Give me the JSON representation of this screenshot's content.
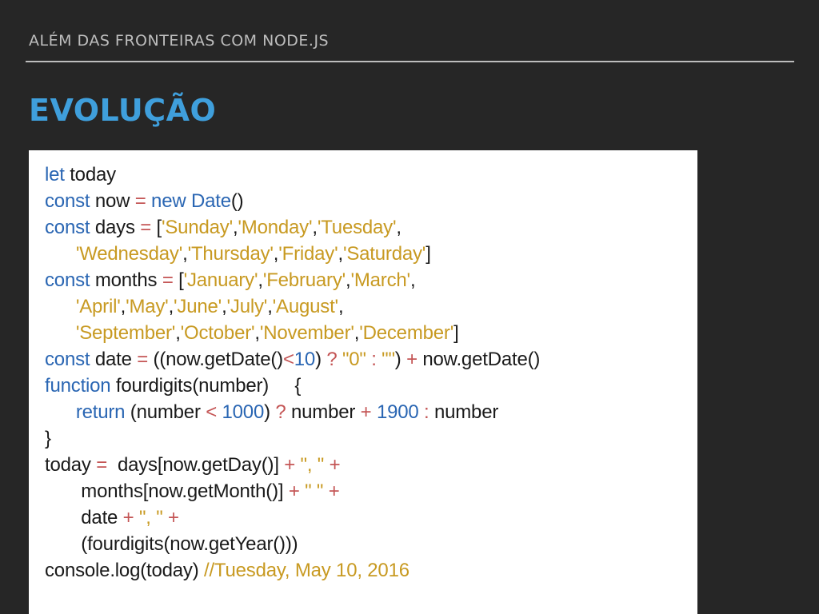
{
  "slide": {
    "header": "ALÉM DAS FRONTEIRAS COM NODE.JS",
    "title": "EVOLUÇÃO"
  },
  "code": {
    "lines": [
      "let today",
      "const now = new Date()",
      "const days = ['Sunday','Monday','Tuesday',",
      "      'Wednesday','Thursday','Friday','Saturday']",
      "const months = ['January','February','March',",
      "      'April','May','June','July','August',",
      "      'September','October','November','December']",
      "const date = ((now.getDate()<10) ? \"0\" : \"\") + now.getDate()",
      "function fourdigits(number)     {",
      "      return (number < 1000) ? number + 1900 : number",
      "}",
      "today =  days[now.getDay()] + \", \" +",
      "       months[now.getMonth()] + \" \" +",
      "       date + \", \" +",
      "       (fourdigits(now.getYear()))",
      "console.log(today) //Tuesday, May 10, 2016"
    ]
  },
  "colors": {
    "background": "#262626",
    "title_accent": "#3f9fdc",
    "keyword": "#2a66b3",
    "string": "#c89a22",
    "operator": "#c45555"
  }
}
